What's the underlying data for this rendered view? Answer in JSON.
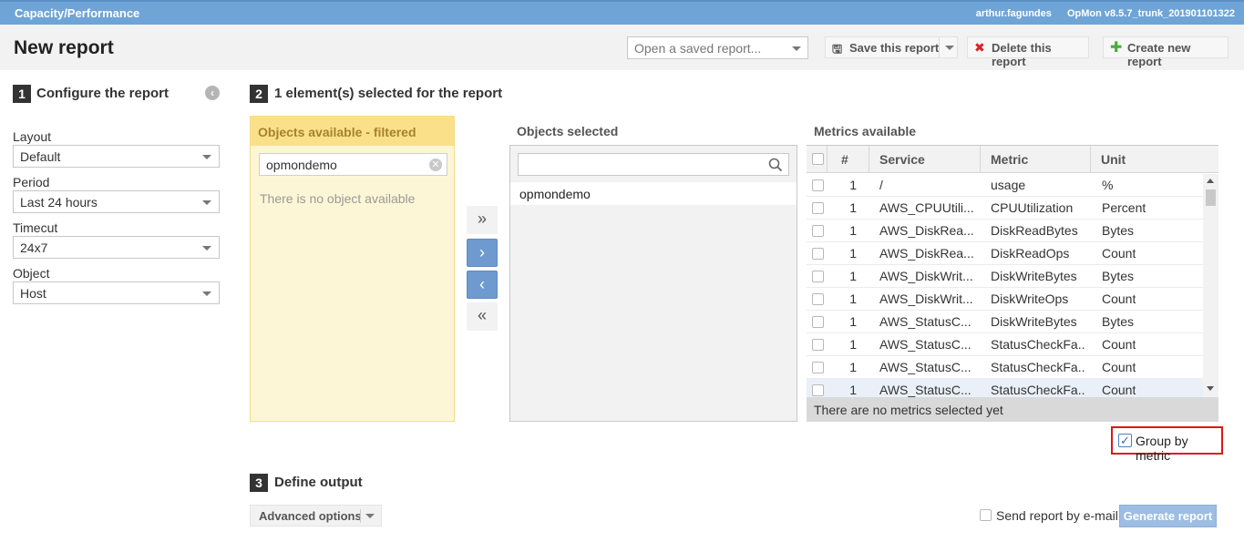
{
  "topbar": {
    "title": "Capacity/Performance",
    "user": "arthur.fagundes",
    "version": "OpMon v8.5.7_trunk_201901101322"
  },
  "header": {
    "title": "New report",
    "saved_report_placeholder": "Open a saved report...",
    "save_label": "Save this report",
    "delete_label": "Delete this report",
    "create_label": "Create new report"
  },
  "configure": {
    "number": "1",
    "title": "Configure the report",
    "layout_label": "Layout",
    "layout_value": "Default",
    "period_label": "Period",
    "period_value": "Last 24 hours",
    "timecut_label": "Timecut",
    "timecut_value": "24x7",
    "object_label": "Object",
    "object_value": "Host"
  },
  "selection": {
    "number": "2",
    "title": "1 element(s) selected for the report",
    "available_header": "Objects available - filtered",
    "filter_value": "opmondemo",
    "empty_message": "There is no object available",
    "selected_header": "Objects selected",
    "selected_items": [
      "opmondemo"
    ]
  },
  "metrics": {
    "header": "Metrics available",
    "columns": {
      "num": "#",
      "service": "Service",
      "metric": "Metric",
      "unit": "Unit"
    },
    "rows": [
      {
        "num": "1",
        "service": "/",
        "metric": "usage",
        "unit": "%"
      },
      {
        "num": "1",
        "service": "AWS_CPUUtili...",
        "metric": "CPUUtilization",
        "unit": "Percent"
      },
      {
        "num": "1",
        "service": "AWS_DiskRea...",
        "metric": "DiskReadBytes",
        "unit": "Bytes"
      },
      {
        "num": "1",
        "service": "AWS_DiskRea...",
        "metric": "DiskReadOps",
        "unit": "Count"
      },
      {
        "num": "1",
        "service": "AWS_DiskWrit...",
        "metric": "DiskWriteBytes",
        "unit": "Bytes"
      },
      {
        "num": "1",
        "service": "AWS_DiskWrit...",
        "metric": "DiskWriteOps",
        "unit": "Count"
      },
      {
        "num": "1",
        "service": "AWS_StatusC...",
        "metric": "DiskWriteBytes",
        "unit": "Bytes"
      },
      {
        "num": "1",
        "service": "AWS_StatusC...",
        "metric": "StatusCheckFa...",
        "unit": "Count"
      },
      {
        "num": "1",
        "service": "AWS_StatusC...",
        "metric": "StatusCheckFa...",
        "unit": "Count"
      },
      {
        "num": "1",
        "service": "AWS_StatusC...",
        "metric": "StatusCheckFa...",
        "unit": "Count"
      }
    ],
    "footer": "There are no metrics selected yet",
    "group_by_label": "Group by metric",
    "group_by_checked": true
  },
  "output": {
    "number": "3",
    "title": "Define output",
    "advanced_label": "Advanced options",
    "send_email_label": "Send report by e-mail",
    "generate_label": "Generate report"
  }
}
